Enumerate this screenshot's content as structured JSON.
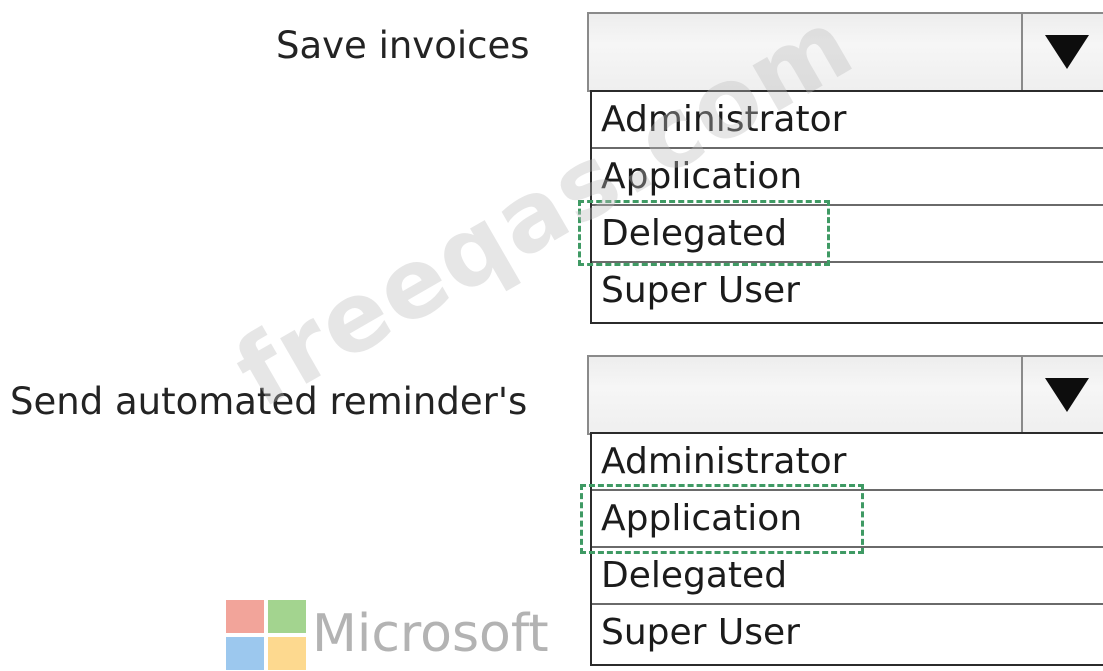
{
  "questions": [
    {
      "label": "Save invoices",
      "selected": "",
      "options": [
        "Administrator",
        "Application",
        "Delegated",
        "Super User"
      ],
      "highlighted_answer": "Delegated"
    },
    {
      "label": "Send automated reminder's",
      "selected": "",
      "options": [
        "Administrator",
        "Application",
        "Delegated",
        "Super User"
      ],
      "highlighted_answer": "Application"
    }
  ],
  "watermark": "freeqas.com",
  "brand": {
    "text": "Microsoft",
    "logo_colors": [
      "#f2a49a",
      "#a3d48f",
      "#9cc8ee",
      "#fdd98f"
    ]
  },
  "colors": {
    "answer_box": "#3f9a64",
    "dropdown_bg": "#efefef",
    "arrow": "#0d0d0d"
  }
}
